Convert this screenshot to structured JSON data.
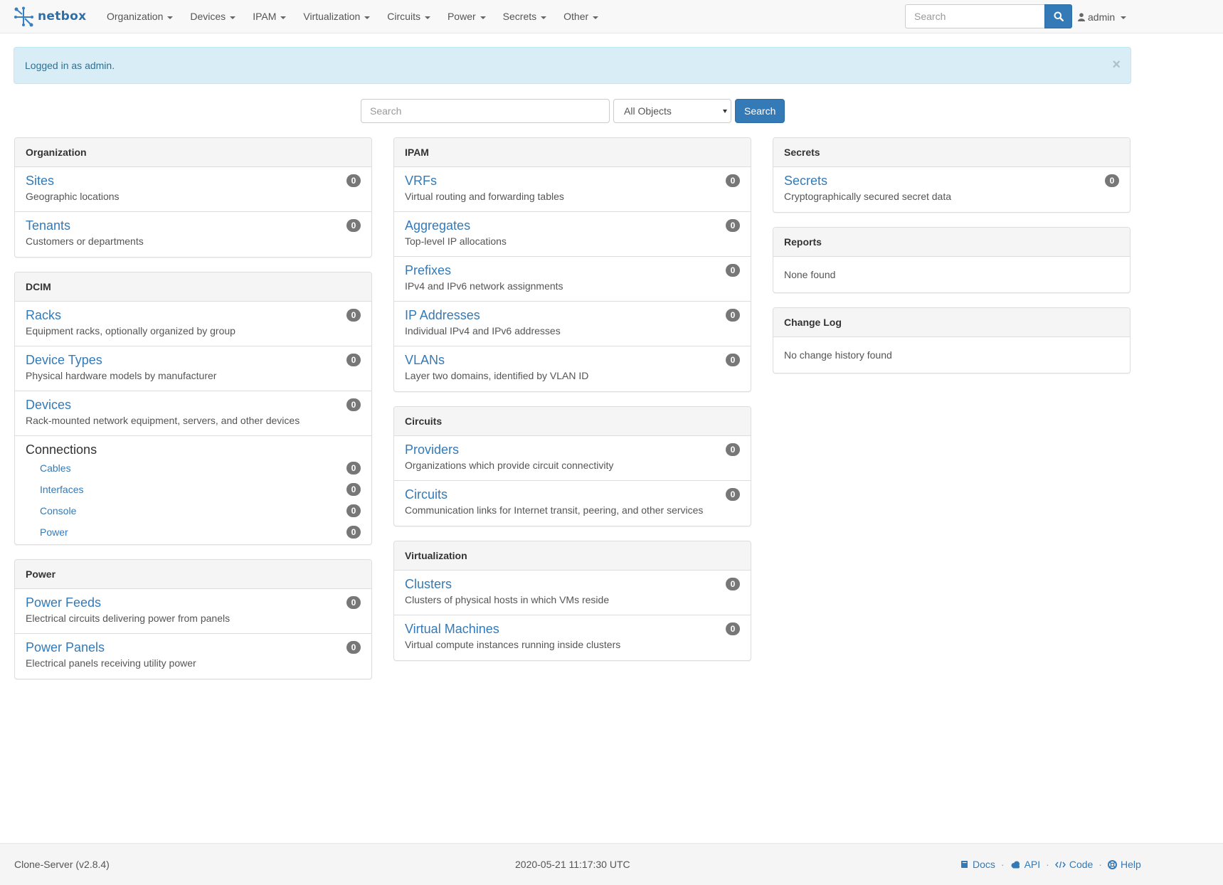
{
  "brand": {
    "name": "netbox"
  },
  "nav": {
    "items": [
      {
        "label": "Organization"
      },
      {
        "label": "Devices"
      },
      {
        "label": "IPAM"
      },
      {
        "label": "Virtualization"
      },
      {
        "label": "Circuits"
      },
      {
        "label": "Power"
      },
      {
        "label": "Secrets"
      },
      {
        "label": "Other"
      }
    ],
    "search_placeholder": "Search",
    "user": "admin"
  },
  "alert": {
    "message": "Logged in as admin.",
    "close": "×"
  },
  "main_search": {
    "placeholder": "Search",
    "scope": "All Objects",
    "button": "Search"
  },
  "organization": {
    "heading": "Organization",
    "items": [
      {
        "title": "Sites",
        "desc": "Geographic locations",
        "count": "0"
      },
      {
        "title": "Tenants",
        "desc": "Customers or departments",
        "count": "0"
      }
    ]
  },
  "dcim": {
    "heading": "DCIM",
    "items": [
      {
        "title": "Racks",
        "desc": "Equipment racks, optionally organized by group",
        "count": "0"
      },
      {
        "title": "Device Types",
        "desc": "Physical hardware models by manufacturer",
        "count": "0"
      },
      {
        "title": "Devices",
        "desc": "Rack-mounted network equipment, servers, and other devices",
        "count": "0"
      }
    ],
    "connections": {
      "title": "Connections",
      "items": [
        {
          "label": "Cables",
          "count": "0"
        },
        {
          "label": "Interfaces",
          "count": "0"
        },
        {
          "label": "Console",
          "count": "0"
        },
        {
          "label": "Power",
          "count": "0"
        }
      ]
    }
  },
  "power": {
    "heading": "Power",
    "items": [
      {
        "title": "Power Feeds",
        "desc": "Electrical circuits delivering power from panels",
        "count": "0"
      },
      {
        "title": "Power Panels",
        "desc": "Electrical panels receiving utility power",
        "count": "0"
      }
    ]
  },
  "ipam": {
    "heading": "IPAM",
    "items": [
      {
        "title": "VRFs",
        "desc": "Virtual routing and forwarding tables",
        "count": "0"
      },
      {
        "title": "Aggregates",
        "desc": "Top-level IP allocations",
        "count": "0"
      },
      {
        "title": "Prefixes",
        "desc": "IPv4 and IPv6 network assignments",
        "count": "0"
      },
      {
        "title": "IP Addresses",
        "desc": "Individual IPv4 and IPv6 addresses",
        "count": "0"
      },
      {
        "title": "VLANs",
        "desc": "Layer two domains, identified by VLAN ID",
        "count": "0"
      }
    ]
  },
  "circuits": {
    "heading": "Circuits",
    "items": [
      {
        "title": "Providers",
        "desc": "Organizations which provide circuit connectivity",
        "count": "0"
      },
      {
        "title": "Circuits",
        "desc": "Communication links for Internet transit, peering, and other services",
        "count": "0"
      }
    ]
  },
  "virtualization": {
    "heading": "Virtualization",
    "items": [
      {
        "title": "Clusters",
        "desc": "Clusters of physical hosts in which VMs reside",
        "count": "0"
      },
      {
        "title": "Virtual Machines",
        "desc": "Virtual compute instances running inside clusters",
        "count": "0"
      }
    ]
  },
  "secrets": {
    "heading": "Secrets",
    "items": [
      {
        "title": "Secrets",
        "desc": "Cryptographically secured secret data",
        "count": "0"
      }
    ]
  },
  "reports": {
    "heading": "Reports",
    "empty": "None found"
  },
  "changelog": {
    "heading": "Change Log",
    "empty": "No change history found"
  },
  "footer": {
    "server": "Clone-Server (v2.8.4)",
    "timestamp": "2020-05-21 11:17:30 UTC",
    "links": [
      {
        "label": "Docs",
        "icon": "book-icon"
      },
      {
        "label": "API",
        "icon": "cloud-icon"
      },
      {
        "label": "Code",
        "icon": "code-icon"
      },
      {
        "label": "Help",
        "icon": "life-ring-icon"
      }
    ],
    "separator": "·"
  },
  "colors": {
    "primary": "#337ab7",
    "alert_bg": "#d9edf7",
    "alert_text": "#31708f",
    "badge": "#777777"
  }
}
